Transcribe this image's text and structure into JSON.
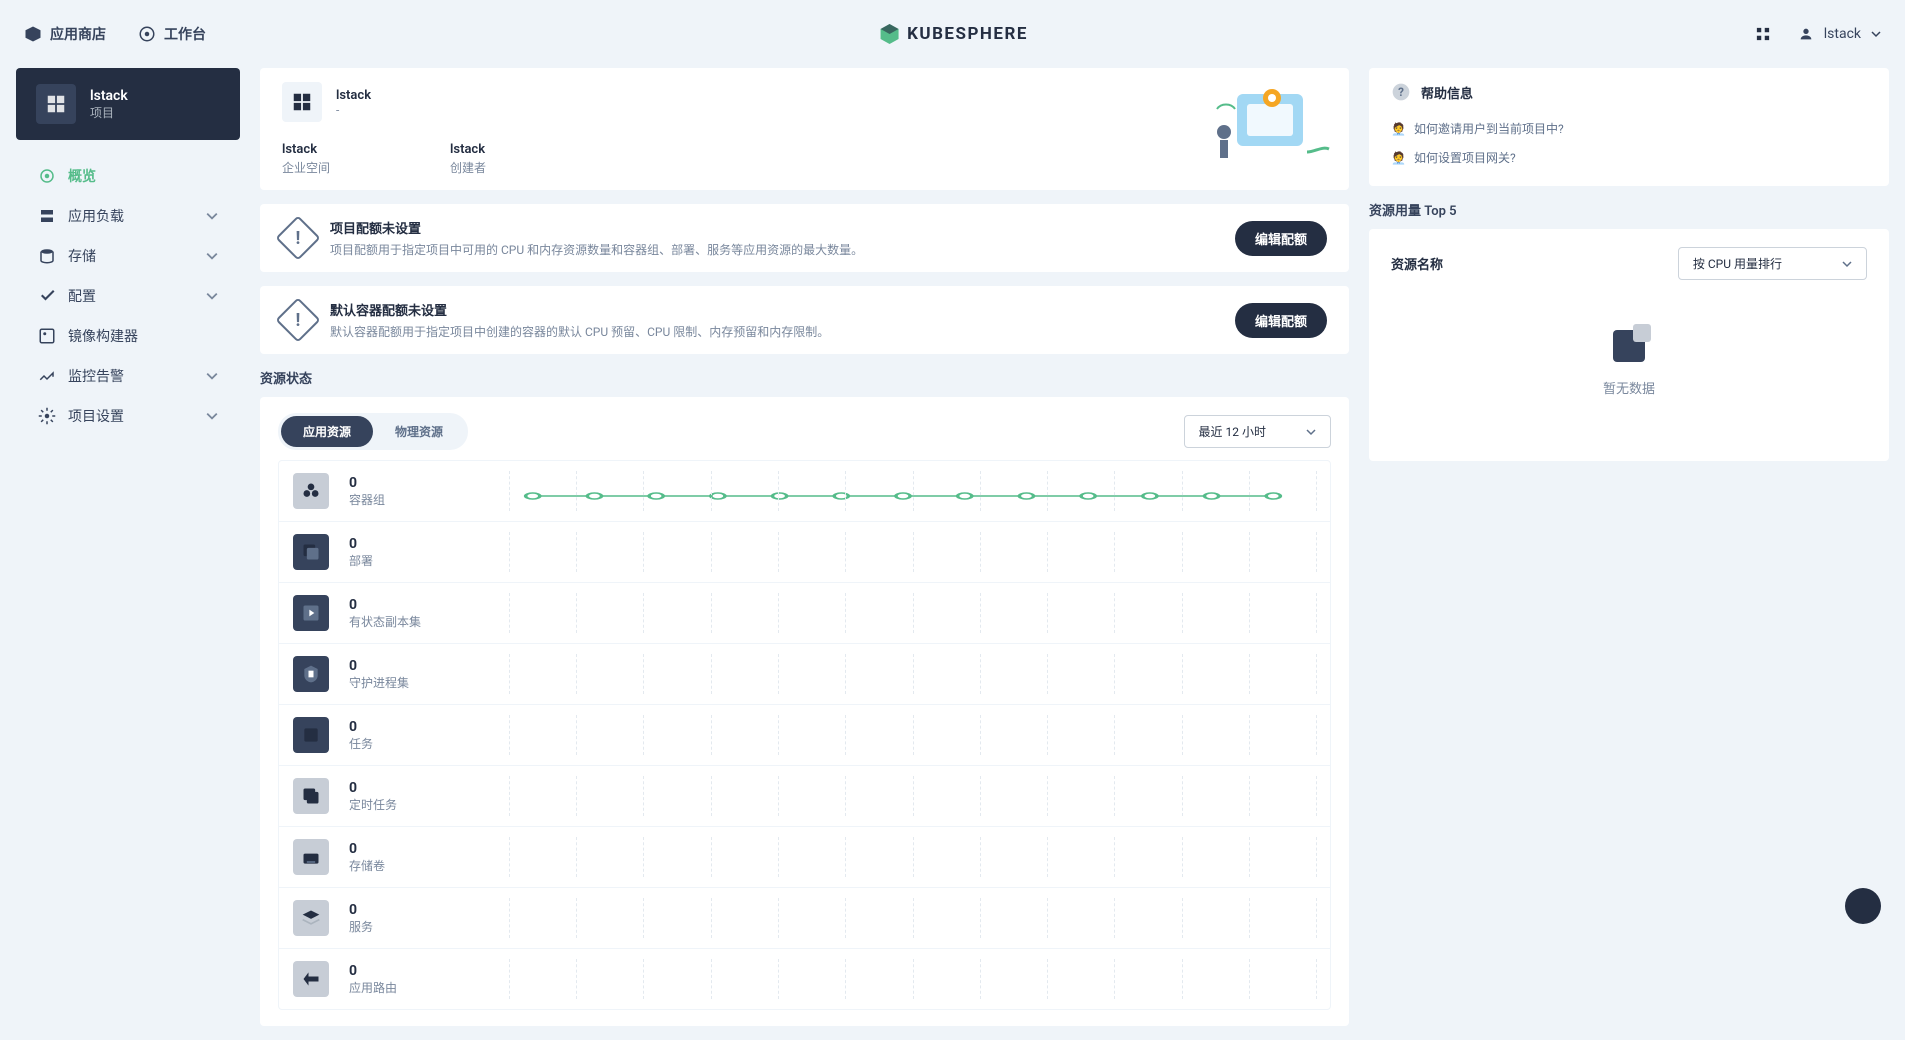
{
  "header": {
    "app_store": "应用商店",
    "workspace": "工作台",
    "brand": "KUBESPHERE",
    "user": "lstack"
  },
  "sidebar": {
    "project_name": "lstack",
    "project_sub": "项目",
    "items": [
      {
        "label": "概览",
        "active": true
      },
      {
        "label": "应用负载",
        "expandable": true
      },
      {
        "label": "存储",
        "expandable": true
      },
      {
        "label": "配置",
        "expandable": true
      },
      {
        "label": "镜像构建器"
      },
      {
        "label": "监控告警",
        "expandable": true
      },
      {
        "label": "项目设置",
        "expandable": true
      }
    ]
  },
  "project_card": {
    "name": "lstack",
    "dash": "-",
    "workspace_value": "lstack",
    "workspace_label": "企业空间",
    "creator_value": "lstack",
    "creator_label": "创建者"
  },
  "alerts": [
    {
      "title": "项目配额未设置",
      "desc": "项目配额用于指定项目中可用的 CPU 和内存资源数量和容器组、部署、服务等应用资源的最大数量。",
      "btn": "编辑配额"
    },
    {
      "title": "默认容器配额未设置",
      "desc": "默认容器配额用于指定项目中创建的容器的默认 CPU 预留、CPU 限制、内存预留和内存限制。",
      "btn": "编辑配额"
    }
  ],
  "resource_status": {
    "title": "资源状态",
    "tabs": {
      "app": "应用资源",
      "phys": "物理资源"
    },
    "time_range": "最近 12 小时",
    "rows": [
      {
        "count": "0",
        "label": "容器组"
      },
      {
        "count": "0",
        "label": "部署"
      },
      {
        "count": "0",
        "label": "有状态副本集"
      },
      {
        "count": "0",
        "label": "守护进程集"
      },
      {
        "count": "0",
        "label": "任务"
      },
      {
        "count": "0",
        "label": "定时任务"
      },
      {
        "count": "0",
        "label": "存储卷"
      },
      {
        "count": "0",
        "label": "服务"
      },
      {
        "count": "0",
        "label": "应用路由"
      }
    ]
  },
  "help": {
    "title": "帮助信息",
    "items": [
      "如何邀请用户到当前项目中?",
      "如何设置项目网关?"
    ]
  },
  "top5": {
    "title": "资源用量 Top 5",
    "name_label": "资源名称",
    "sort_by": "按 CPU 用量排行",
    "empty": "暂无数据"
  },
  "chart_data": {
    "type": "line",
    "series": [
      {
        "name": "容器组",
        "values": [
          0,
          0,
          0,
          0,
          0,
          0,
          0,
          0,
          0,
          0,
          0,
          0,
          0
        ]
      }
    ],
    "ylim": [
      0,
      1
    ]
  }
}
